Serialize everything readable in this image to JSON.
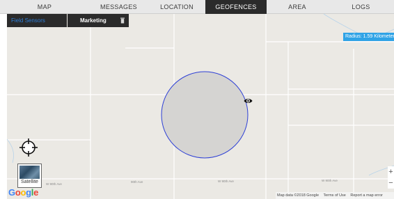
{
  "tabs": [
    {
      "label": "MAP"
    },
    {
      "label": "MESSAGES"
    },
    {
      "label": "LOCATION HISTORY"
    },
    {
      "label": "GEOFENCES",
      "active": true
    },
    {
      "label": "AREA TALKGROUPS"
    },
    {
      "label": "LOGS"
    }
  ],
  "geofence": {
    "select_label": "Field Sensors",
    "name": "Marketing",
    "radius_text": "Radius: 1.59 Kilometers"
  },
  "map": {
    "satellite_label": "Satellite",
    "streets": [
      "W 90th Ave",
      "90th Ave",
      "W 90th Ave",
      "W 90th Ave"
    ],
    "attribution": [
      "Map data ©2018 Google",
      "Terms of Use",
      "Report a map error"
    ],
    "zoom_in": "+",
    "zoom_out": "−",
    "logo": "Google"
  },
  "colors": {
    "active_tab": "#2b2b2b",
    "accent_blue": "#2fa3e6",
    "fence_stroke": "#2d3fd6",
    "fence_fill": "#d5d4d2"
  },
  "icons": [
    "trash-icon",
    "locate-icon",
    "eye-icon"
  ]
}
